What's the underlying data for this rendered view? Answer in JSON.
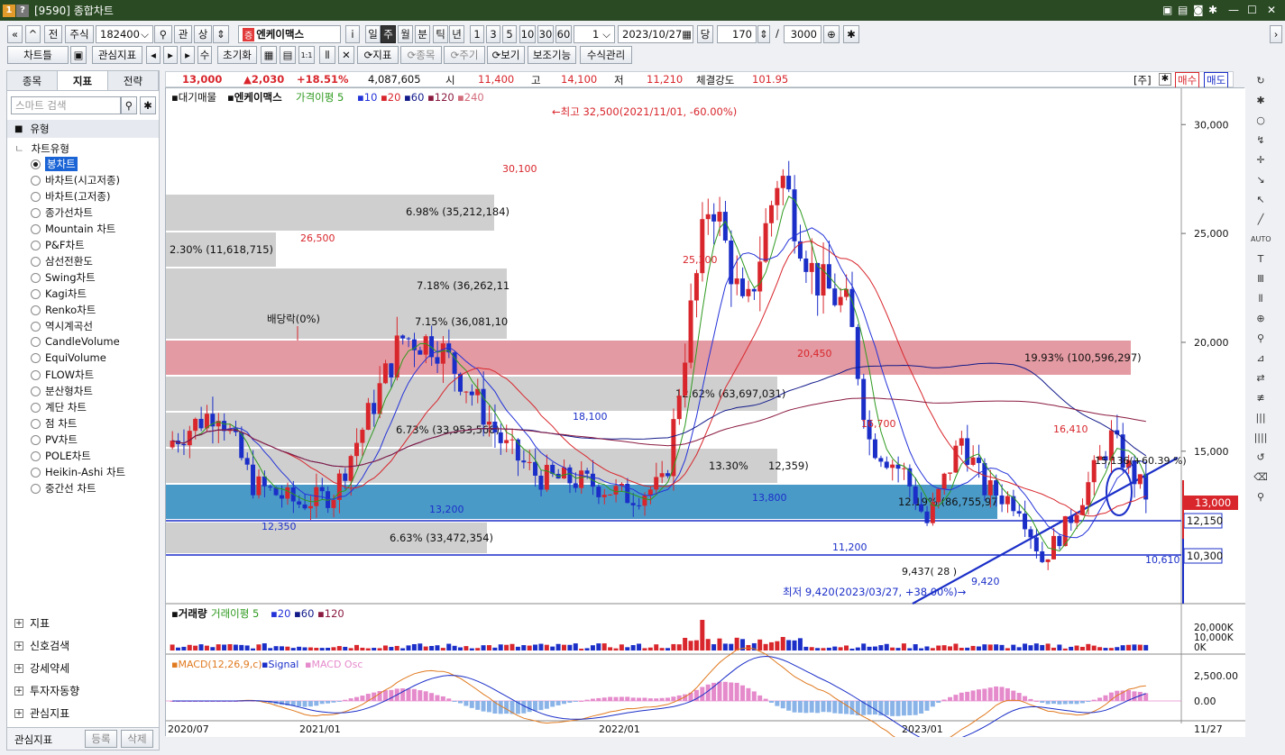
{
  "window": {
    "badge": "1",
    "title": "[9590] 종합차트"
  },
  "toolbar": {
    "prev_all": "«",
    "prev": "«",
    "jeon": "전",
    "market": "주식",
    "code": "182400",
    "gwan": "관",
    "sang": "상",
    "stock_tag": "증",
    "stock_name": "엔케이맥스",
    "info_btn": "i",
    "periods": [
      "일",
      "주",
      "월",
      "분",
      "틱",
      "년"
    ],
    "active_period": "주",
    "nums": [
      "1",
      "3",
      "5",
      "10",
      "30",
      "60"
    ],
    "period_count": "1",
    "date": "2023/10/27",
    "dang": "당",
    "count": "170",
    "slash": "/",
    "total": "3000"
  },
  "toolbar2": {
    "chart_list": "차트틀",
    "indicators_label": "관심지표",
    "su": "수",
    "reset": "초기화",
    "indicator": "지표",
    "stock": "종목",
    "cycle": "주기",
    "view": "보기",
    "aux": "보조기능",
    "formula": "수식관리"
  },
  "left": {
    "tabs": [
      "종목",
      "지표",
      "전략"
    ],
    "active_tab": "지표",
    "search_placeholder": "스마트 검색",
    "section": "유형",
    "group": "차트유형",
    "types": [
      "봉차트",
      "바차트(시고저종)",
      "바차트(고저종)",
      "종가선차트",
      "Mountain 차트",
      "P&F차트",
      "삼선전환도",
      "Swing차트",
      "Kagi차트",
      "Renko차트",
      "역시계곡선",
      "CandleVolume",
      "EquiVolume",
      "FLOW차트",
      "분산형차트",
      "계단 차트",
      "점 차트",
      "PV차트",
      "POLE차트",
      "Heikin-Ashi 차트",
      "중간선 차트"
    ],
    "selected_type": "봉차트",
    "bottom": [
      "지표",
      "신호검색",
      "강세약세",
      "투자자동향",
      "관심지표"
    ],
    "fav_label": "관심지표",
    "reg": "등록",
    "del": "삭제"
  },
  "quote": {
    "price": "13,000",
    "change": "▲2,030",
    "rate": "+18.51%",
    "volume": "4,087,605",
    "open_label": "시",
    "open": "11,400",
    "high_label": "고",
    "high": "14,100",
    "low_label": "저",
    "low": "11,210",
    "strength_label": "체결강도",
    "strength": "101.95",
    "ju": "[주]",
    "buy": "매수",
    "sell": "매도"
  },
  "legend": {
    "main": "대기매물",
    "name": "엔케이맥스",
    "ma_label": "가격이평 5",
    "mas": [
      "10",
      "20",
      "60",
      "120",
      "240"
    ],
    "vol": "거래량",
    "vol_ma": "거래이평 5",
    "vol_mas": [
      "20",
      "60",
      "120"
    ],
    "macd": "MACD(12,26,9,c)",
    "signal": "Signal",
    "osc": "MACD Osc"
  },
  "colors": {
    "up": "#d8262c",
    "down": "#1b2fc8",
    "ma5": "#2e9a1f",
    "ma10": "#2433d8",
    "ma20": "#d8262c",
    "ma60": "#121a8a",
    "ma120": "#8a1a40",
    "band_red": "#e49aa2",
    "band_blue": "#4a9ac8",
    "band_gray": "#cfcfcf"
  },
  "annotations": {
    "max": "←최고 32,500(2021/11/01, -60.00%)",
    "min": "최저 9,420(2023/03/27, +38.00%)→",
    "div": "배당락(0%)",
    "peaks": [
      "30,100",
      "26,500",
      "25,300",
      "20,450",
      "16,700",
      "16,410",
      "18,100",
      "13,200",
      "12,350",
      "13,800",
      "11,200",
      "9,420",
      "10,610",
      "9,437( 28 )",
      "15,136(+60.39 %)"
    ]
  },
  "bands": [
    "6.98% (35,212,184)",
    "2.30% (11,618,715)",
    "7.18% (36,262,11",
    "7.15% (36,081,10",
    "19.93% (100,596,297)",
    "12.62% (63,697,031)",
    "6.73% (33,953,568)",
    "13.30%",
    "12,359)",
    "12.19% (86,755,97",
    "6.63% (33,472,354)"
  ],
  "yaxis": {
    "ticks": [
      "30,000",
      "25,000",
      "20,000",
      "15,000"
    ],
    "current": "13,000",
    "level1": "12,150",
    "level2": "10,300",
    "vol_ticks": [
      "20,000K",
      "10,000K",
      "0K"
    ],
    "macd_ticks": [
      "2,500.00",
      "0.00"
    ]
  },
  "xaxis": {
    "labels": [
      "2020/07",
      "2021/01",
      "2022/01",
      "2023/01",
      "11/27"
    ]
  }
}
